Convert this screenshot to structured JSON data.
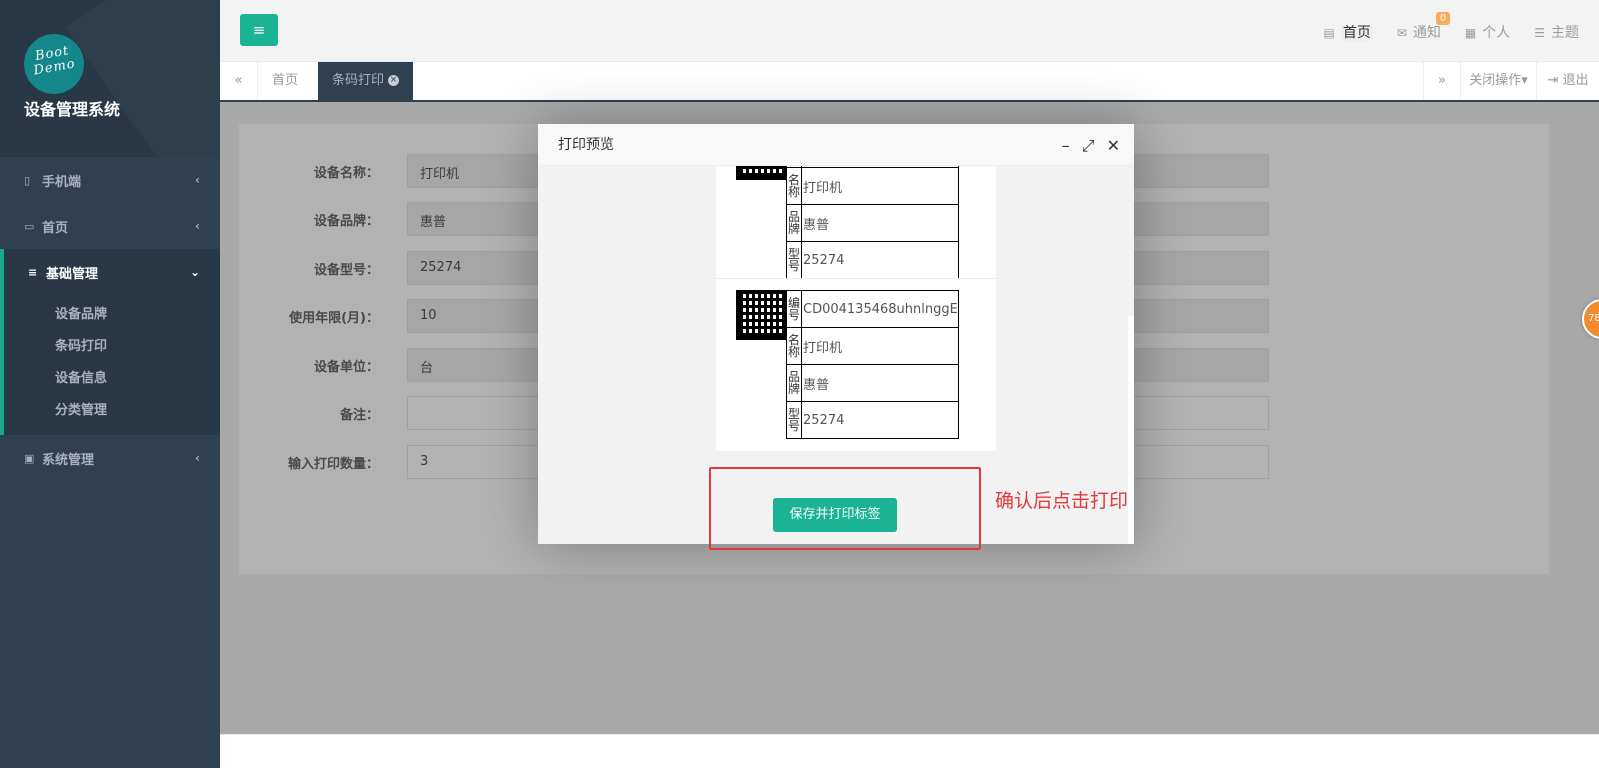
{
  "sidebar": {
    "logo_text_line1": "Boot",
    "logo_text_line2": "Demo",
    "system_name": "设备管理系统",
    "items": [
      {
        "label": "手机端",
        "icon": "mobile-icon"
      },
      {
        "label": "首页",
        "icon": "folder-icon"
      },
      {
        "label": "基础管理",
        "icon": "list-icon"
      },
      {
        "label": "系统管理",
        "icon": "desktop-icon"
      }
    ],
    "submenu": [
      "设备品牌",
      "条码打印",
      "设备信息",
      "分类管理"
    ]
  },
  "topbar": {
    "home": "首页",
    "notify": "通知",
    "notify_count": "0",
    "personal": "个人",
    "theme": "主题"
  },
  "tabs": {
    "items": [
      "首页",
      "条码打印"
    ],
    "close_ops": "关闭操作",
    "logout": "退出"
  },
  "form": {
    "fields": [
      {
        "label": "设备名称：",
        "value": "打印机"
      },
      {
        "label": "设备品牌：",
        "value": "惠普"
      },
      {
        "label": "设备型号：",
        "value": "25274"
      },
      {
        "label": "使用年限(月)：",
        "value": "10"
      },
      {
        "label": "设备单位：",
        "value": "台"
      },
      {
        "label": "备注：",
        "value": ""
      },
      {
        "label": "输入打印数量：",
        "value": "3"
      }
    ]
  },
  "dialog": {
    "title": "打印预览",
    "label_keys": {
      "code": "编号",
      "name": "名称",
      "brand": "品牌",
      "model": "型号"
    },
    "label_card": {
      "code": "CD004135468uhnlnggE",
      "name": "打印机",
      "brand": "惠普",
      "model": "25274"
    },
    "print_button": "保存并打印标签"
  },
  "annotation": "确认后点击打印",
  "float_ball": "78",
  "colors": {
    "sidebar_bg": "#2f4050",
    "accent": "#1ab394",
    "annotation_red": "#e4393c",
    "badge": "#f8ac59"
  }
}
